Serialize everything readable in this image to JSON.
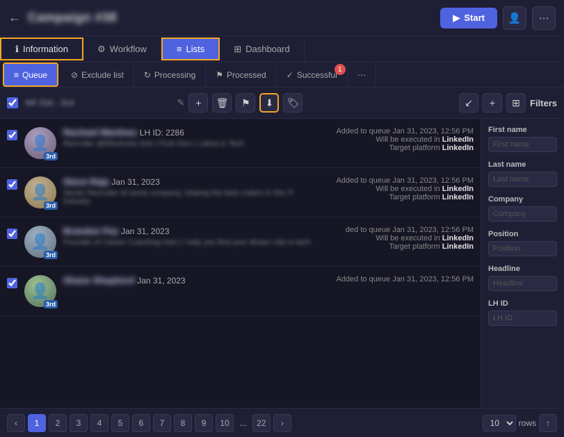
{
  "header": {
    "back_label": "←",
    "campaign_title": "Campaign #38",
    "start_label": "Start",
    "play_icon": "▶",
    "icon1": "👤",
    "icon2": "⋯"
  },
  "tabs1": [
    {
      "id": "information",
      "label": "Information",
      "icon": "ℹ",
      "active": false,
      "outlined": true
    },
    {
      "id": "workflow",
      "label": "Workflow",
      "icon": "⚙",
      "active": false
    },
    {
      "id": "lists",
      "label": "Lists",
      "icon": "≡",
      "active": true,
      "outlined": true
    },
    {
      "id": "dashboard",
      "label": "Dashboard",
      "icon": "⊞",
      "active": false
    }
  ],
  "tabs2": [
    {
      "id": "queue",
      "label": "Queue",
      "icon": "≡",
      "active": true,
      "outlined": true
    },
    {
      "id": "exclude-list",
      "label": "Exclude list",
      "icon": "⊘",
      "active": false
    },
    {
      "id": "processing",
      "label": "Processing",
      "icon": "↻",
      "active": false
    },
    {
      "id": "processed",
      "label": "Processed",
      "icon": "⚑",
      "active": false
    },
    {
      "id": "successful",
      "label": "Successful",
      "icon": "✓",
      "active": false,
      "badge": "1"
    },
    {
      "id": "more",
      "label": "⋯",
      "icon": "⋯",
      "active": false
    }
  ],
  "toolbar": {
    "count": "AR 316 - 314",
    "add_icon": "+",
    "delete_icon": "🗑",
    "filter_icon": "⚑",
    "download_icon": "⬇",
    "tag_icon": "🏷",
    "collapse_icon": "↙",
    "plus_icon": "+",
    "grid_icon": "⊞"
  },
  "filters": {
    "title": "Filters",
    "fields": [
      {
        "label": "First name",
        "placeholder": "First name"
      },
      {
        "label": "Last name",
        "placeholder": "Last name"
      },
      {
        "label": "Company",
        "placeholder": "Company"
      },
      {
        "label": "Position",
        "placeholder": "Position"
      },
      {
        "label": "Headline",
        "placeholder": "Headline"
      },
      {
        "label": "LH ID",
        "placeholder": "LH ID"
      }
    ]
  },
  "items": [
    {
      "id": 1,
      "name": "Rachael Martinez",
      "lhid": "LH ID: 2286",
      "desc": "Recruiter @Electronic Arts | First-Gen | Latina in Tech",
      "degree": "3rd",
      "added": "Added to queue Jan 31, 2023, 12:56 PM",
      "executed_in": "LinkedIn",
      "target_platform": "LinkedIn",
      "checked": true,
      "avatar_class": "av1"
    },
    {
      "id": 2,
      "name": "Steve Raja",
      "lhid": "Jan 31, 2023",
      "desc": "Senior Recruiter at some company, helping the best coders in the IT Industry",
      "degree": "3rd",
      "added": "Added to queue Jan 31, 2023, 12:56 PM",
      "executed_in": "LinkedIn",
      "target_platform": "LinkedIn",
      "checked": true,
      "avatar_class": "av2"
    },
    {
      "id": 3,
      "name": "Brandon Paz",
      "lhid": "Jan 31, 2023",
      "desc": "Founder of Career Coaching Hub | I help you find your dream role in tech",
      "degree": "3rd",
      "added": "ded to queue Jan 31, 2023, 12:56 PM",
      "executed_in": "LinkedIn",
      "target_platform": "LinkedIn",
      "checked": true,
      "avatar_class": "av3"
    },
    {
      "id": 4,
      "name": "Shane Shepherd",
      "lhid": "Jan 31, 2023",
      "desc": "",
      "degree": "3rd",
      "added": "Added to queue Jan 31, 2023, 12:56 PM",
      "executed_in": "",
      "target_platform": "",
      "checked": true,
      "avatar_class": "av4"
    }
  ],
  "pagination": {
    "prev": "‹",
    "next": "›",
    "pages": [
      1,
      2,
      3,
      4,
      5,
      6,
      7,
      8,
      9,
      10
    ],
    "ellipsis": "...",
    "last": 22,
    "current": 1,
    "rows_label": "rows",
    "rows_value": "10",
    "up_icon": "↑"
  }
}
